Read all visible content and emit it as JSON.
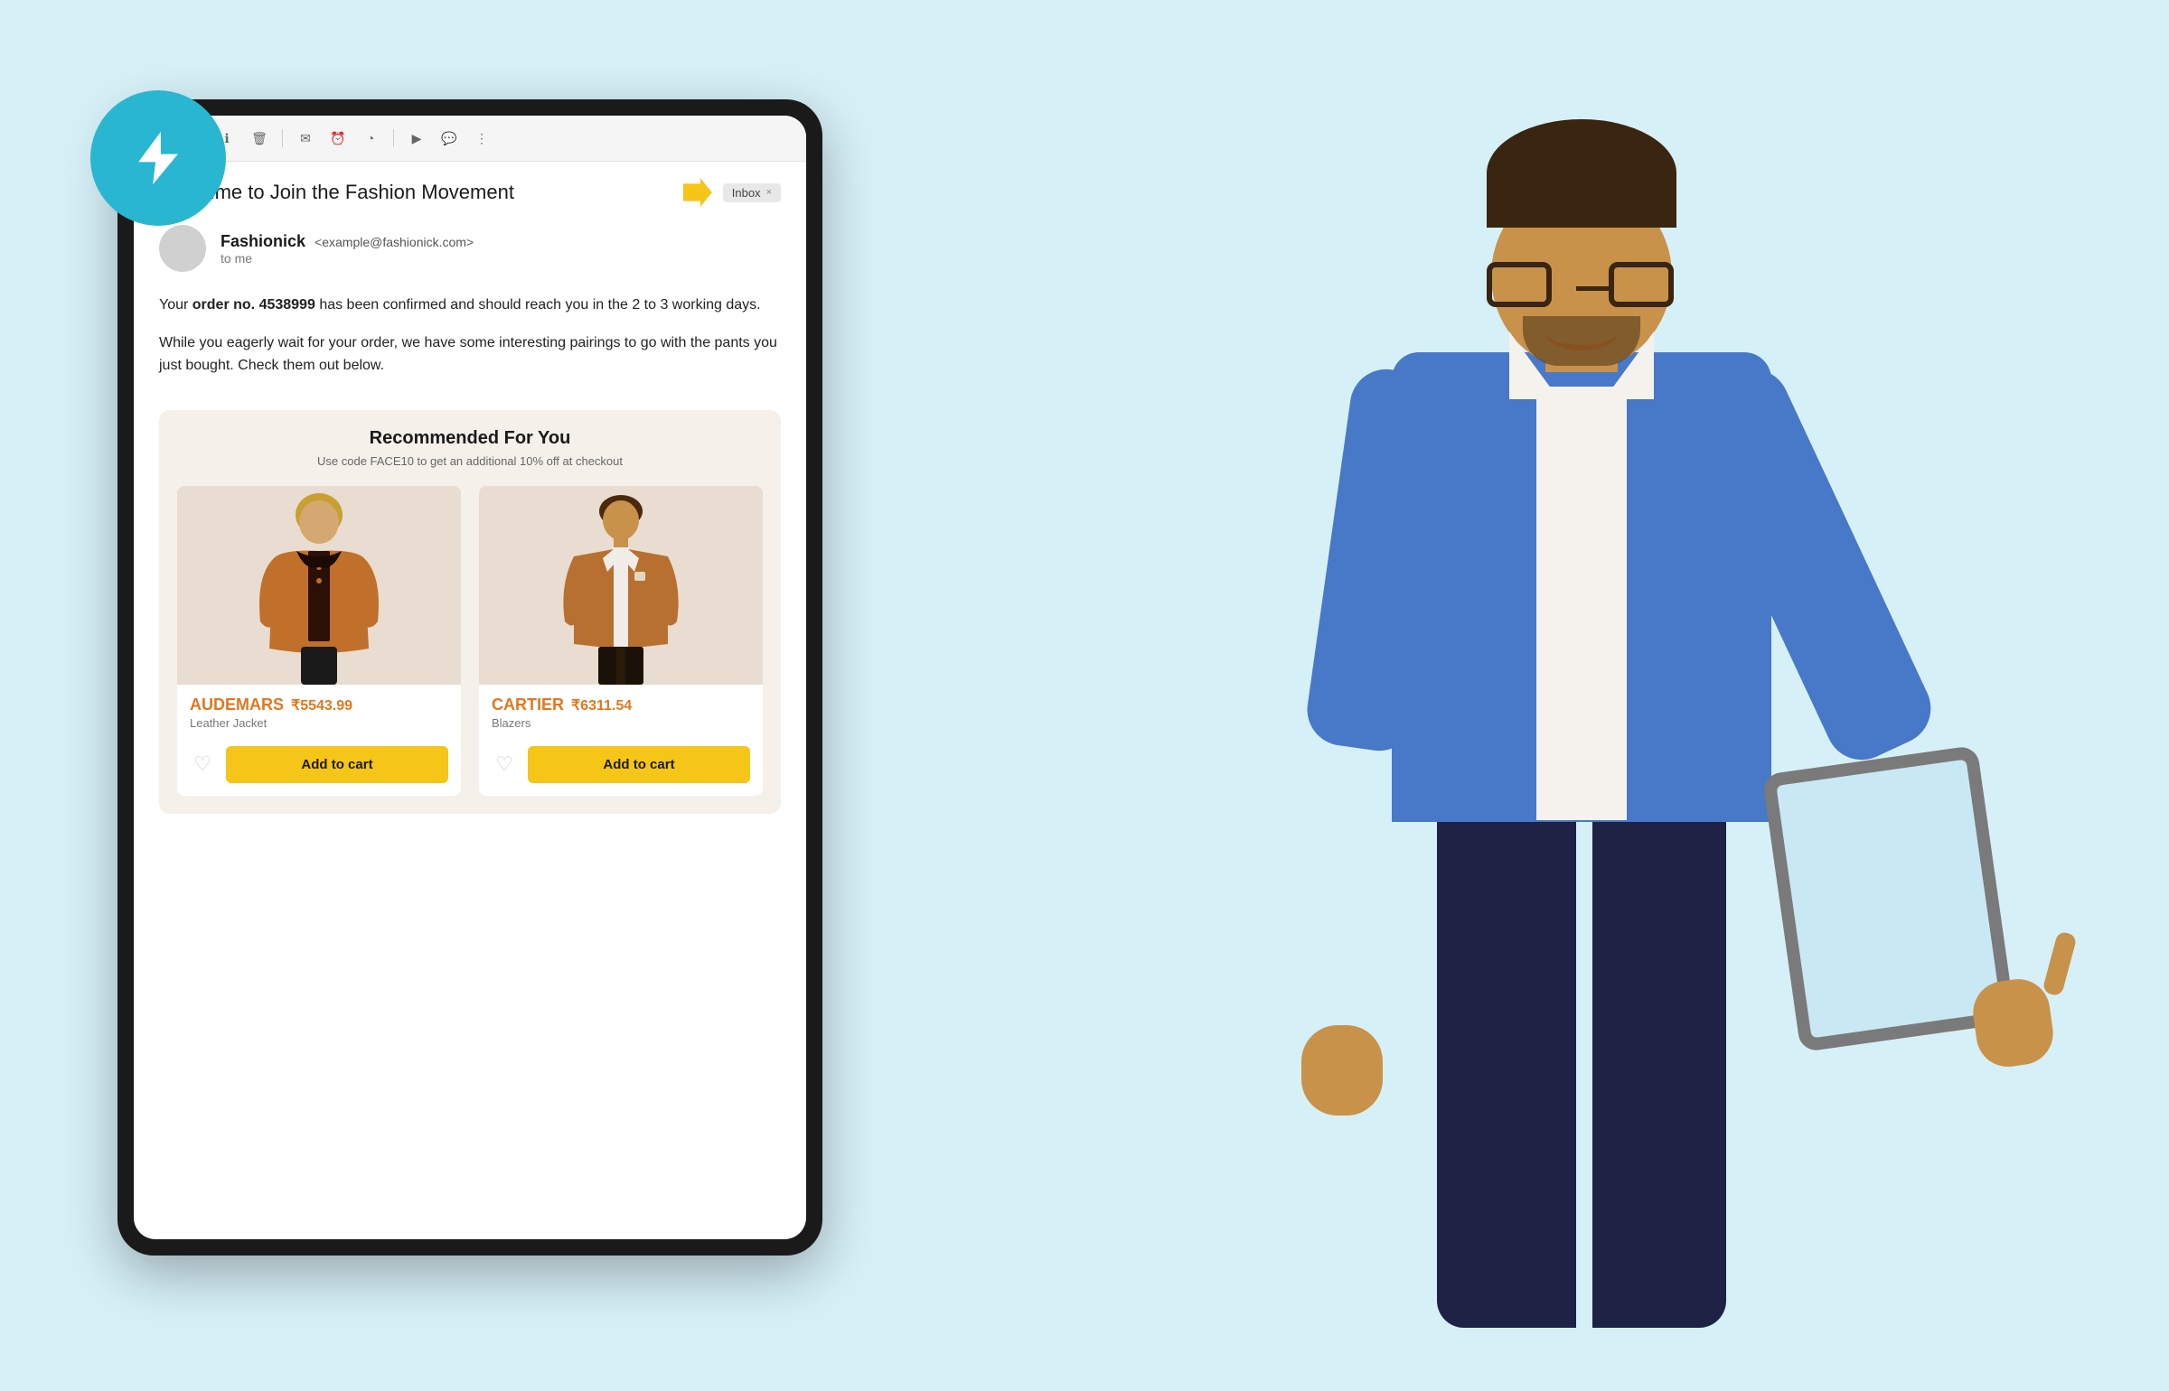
{
  "page": {
    "background_color": "#d6f0f7"
  },
  "lightning_badge": {
    "icon": "lightning-bolt"
  },
  "email": {
    "toolbar": {
      "back_icon": "←",
      "archive_icon": "▣",
      "info_icon": "ℹ",
      "delete_icon": "🗑",
      "mail_icon": "✉",
      "snooze_icon": "⏰",
      "label_icon": "◔",
      "divider": "|",
      "youtube_icon": "▶",
      "chat_icon": "💬",
      "more_icon": "⋮"
    },
    "subject": "Your time to Join the Fashion Movement",
    "inbox_badge": "Inbox",
    "inbox_close": "×",
    "sender": {
      "name": "Fashionick",
      "email": "<example@fashionick.com>",
      "to_label": "to me"
    },
    "body_p1_pre": "Your ",
    "body_p1_bold": "order no. 4538999",
    "body_p1_post": " has been confirmed and should reach you in the 2 to 3 working days.",
    "body_p2": "While you eagerly wait for your order, we have some interesting pairings to go with the pants you just bought. Check them out below.",
    "recommended": {
      "title": "Recommended For You",
      "subtitle": "Use code FACE10 to get an additional 10% off at checkout",
      "products": [
        {
          "brand": "AUDEMARS",
          "price": "₹5543.99",
          "type": "Leather Jacket",
          "add_to_cart_label": "Add to cart",
          "heart_icon": "♡"
        },
        {
          "brand": "CARTIER",
          "price": "₹6311.54",
          "type": "Blazers",
          "add_to_cart_label": "Add to cart",
          "heart_icon": "♡"
        }
      ]
    }
  }
}
